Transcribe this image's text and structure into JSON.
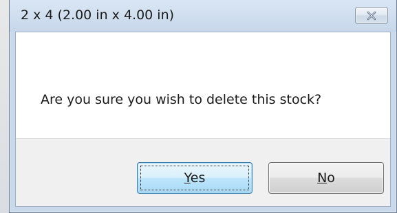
{
  "dialog": {
    "title": "2 x 4 (2.00 in x 4.00 in)",
    "message": "Are you sure you wish to delete this stock?",
    "close_icon": "close-x-icon",
    "buttons": {
      "yes": {
        "mnemonic": "Y",
        "rest": "es",
        "is_default": true
      },
      "no": {
        "mnemonic": "N",
        "rest": "o",
        "is_default": false
      }
    }
  },
  "colors": {
    "title_bar": "#c7d7ea",
    "client_bg": "#ffffff",
    "button_bar_bg": "#f0f0f0",
    "default_button_border": "#3c7fb1"
  }
}
